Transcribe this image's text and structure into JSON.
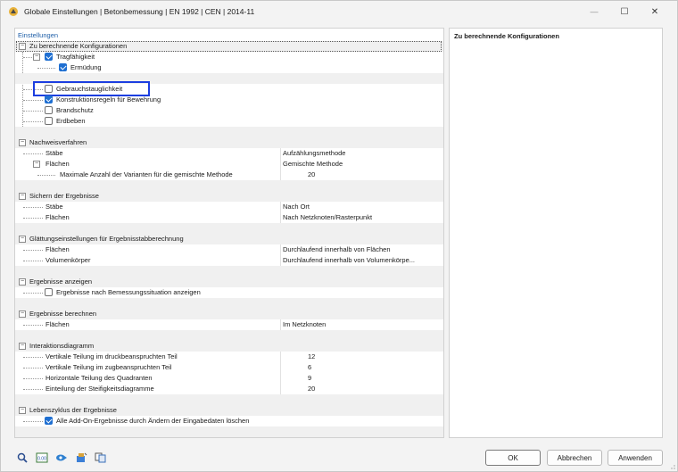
{
  "window": {
    "title": "Globale Einstellungen | Betonbemessung | EN 1992 | CEN | 2014-11",
    "minimize_glyph": "—",
    "maximize_glyph": "☐",
    "close_glyph": "✕"
  },
  "tree": {
    "section_label": "Einstellungen",
    "konfig": {
      "header": "Zu berechnende Konfigurationen",
      "tragfaehigkeit": "Tragfähigkeit",
      "ermuedung": "Ermüdung",
      "gebrauch": "Gebrauchstauglichkeit",
      "konstruktion": "Konstruktionsregeln für Bewehrung",
      "brandschutz": "Brandschutz",
      "erdbeben": "Erdbeben"
    },
    "nachweis": {
      "header": "Nachweisverfahren",
      "staebe": "Stäbe",
      "staebe_val": "Aufzählungsmethode",
      "flaechen": "Flächen",
      "flaechen_val": "Gemischte Methode",
      "max_label": "Maximale Anzahl der Varianten für die gemischte Methode",
      "max_val": "20"
    },
    "sichern": {
      "header": "Sichern der Ergebnisse",
      "staebe": "Stäbe",
      "staebe_val": "Nach Ort",
      "flaechen": "Flächen",
      "flaechen_val": "Nach Netzknoten/Rasterpunkt"
    },
    "glaettung": {
      "header": "Glättungseinstellungen für Ergebnisstabberechnung",
      "flaechen": "Flächen",
      "flaechen_val": "Durchlaufend innerhalb von Flächen",
      "volumen": "Volumenkörper",
      "volumen_val": "Durchlaufend innerhalb von Volumenkörpe..."
    },
    "anzeigen": {
      "header": "Ergebnisse anzeigen",
      "item": "Ergebnisse nach Bemessungssituation anzeigen"
    },
    "berechnen": {
      "header": "Ergebnisse berechnen",
      "flaechen": "Flächen",
      "flaechen_val": "Im Netzknoten"
    },
    "interaktion": {
      "header": "Interaktionsdiagramm",
      "r1": "Vertikale Teilung im druckbeanspruchten Teil",
      "r1_val": "12",
      "r2": "Vertikale Teilung im zugbeanspruchten Teil",
      "r2_val": "6",
      "r3": "Horizontale Teilung des Quadranten",
      "r3_val": "9",
      "r4": "Einteilung der Steifigkeitsdiagramme",
      "r4_val": "20"
    },
    "lebenszyklus": {
      "header": "Lebenszyklus der Ergebnisse",
      "item": "Alle Add-On-Ergebnisse durch Ändern der Eingabedaten löschen"
    },
    "expander_open": "−"
  },
  "description": {
    "title": "Zu berechnende Konfigurationen"
  },
  "buttons": {
    "ok": "OK",
    "cancel": "Abbrechen",
    "apply": "Anwenden"
  },
  "toolbar_icons": [
    "search-icon",
    "units-icon",
    "view-icon",
    "save-icon",
    "copy-icon"
  ],
  "units_icon_text": "0.00",
  "colors": {
    "accent": "#1f6fd1",
    "focus": "#1c3ee0",
    "section": "#1f5fa8"
  }
}
